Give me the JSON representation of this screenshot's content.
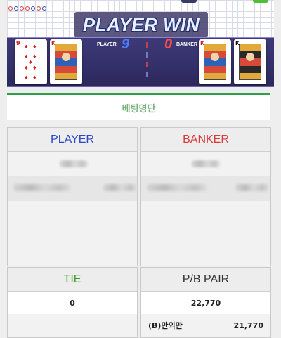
{
  "game": {
    "result_banner": "PLAYER WIN",
    "player_label": "PLAYER",
    "player_score": "9",
    "banker_label": "BANKER",
    "banker_score": "0",
    "player_cards": [
      {
        "rank": "9",
        "suit": "♦"
      },
      {
        "rank": "K",
        "suit": "♦"
      }
    ],
    "banker_cards": [
      {
        "rank": "K",
        "suit": "♦"
      },
      {
        "rank": "K",
        "suit": "♠"
      }
    ],
    "colors": {
      "player": "#2c49c9",
      "banker": "#d93a3a",
      "tie": "#3a9a2a"
    }
  },
  "tab": {
    "label": "베팅명단"
  },
  "panels": {
    "player": {
      "title": "PLAYER"
    },
    "banker": {
      "title": "BANKER"
    },
    "tie": {
      "title": "TIE",
      "total": "0"
    },
    "pair": {
      "title": "P/B PAIR",
      "total": "22,770",
      "rows": [
        {
          "name": "(B)만외만",
          "amount": "21,770"
        }
      ]
    }
  }
}
